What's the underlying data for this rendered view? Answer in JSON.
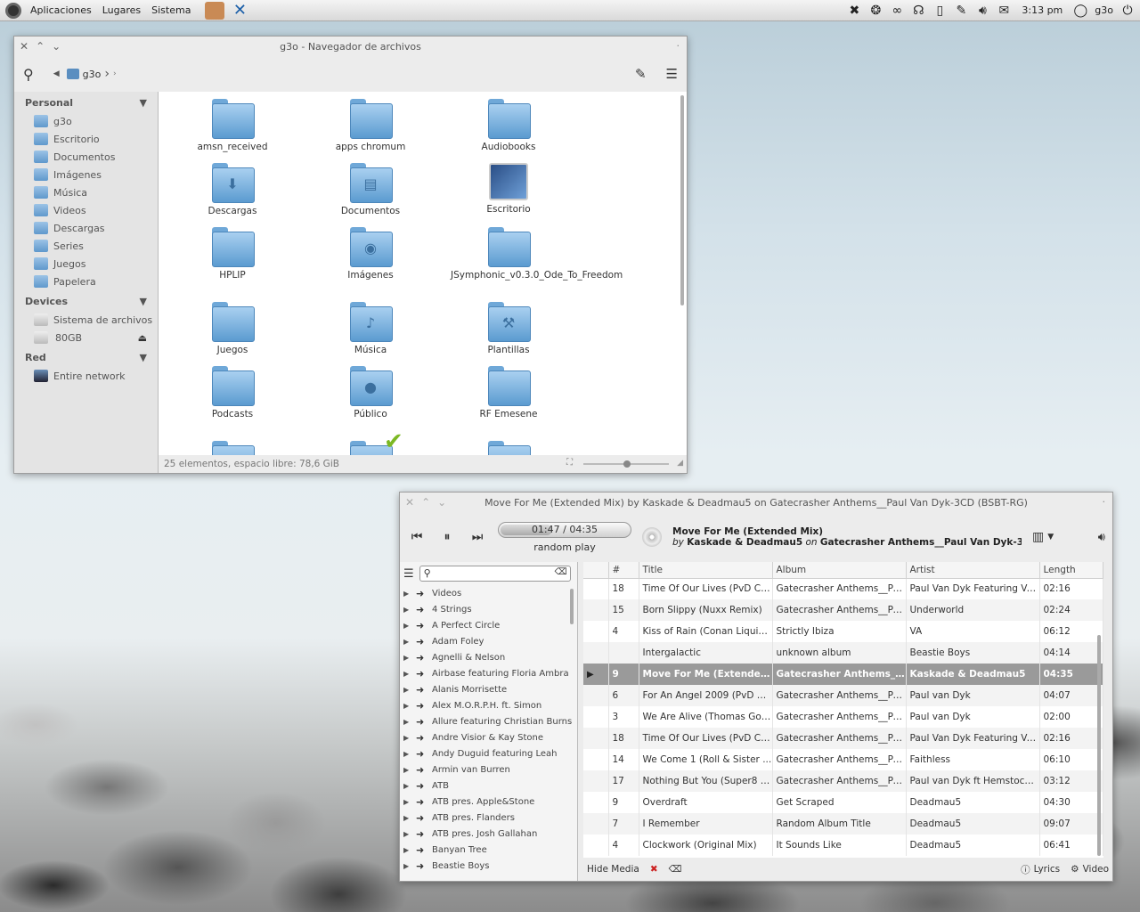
{
  "panel": {
    "menus": [
      "Aplicaciones",
      "Lugares",
      "Sistema"
    ],
    "clock": "3:13 pm",
    "user": "g3o"
  },
  "fm": {
    "title": "g3o - Navegador de archivos",
    "crumb": "g3o",
    "sections": {
      "personal": "Personal",
      "devices": "Devices",
      "network": "Red"
    },
    "personal": [
      "g3o",
      "Escritorio",
      "Documentos",
      "Imágenes",
      "Música",
      "Videos",
      "Descargas",
      "Series",
      "Juegos",
      "Papelera"
    ],
    "devices": [
      "Sistema de archivos",
      "80GB"
    ],
    "network": [
      "Entire network"
    ],
    "icons": [
      "amsn_received",
      "apps chromum",
      "Audiobooks",
      "Descargas",
      "Documentos",
      "Escritorio",
      "HPLIP",
      "Imágenes",
      "JSymphonic_v0.3.0_Ode_To_Freedom",
      "Juegos",
      "Música",
      "Plantillas",
      "Podcasts",
      "Público",
      "RF Emesene"
    ],
    "status": "25 elementos, espacio libre: 78,6 GiB"
  },
  "mp": {
    "title": "Move For Me (Extended Mix) by Kaskade & Deadmau5 on Gatecrasher Anthems__Paul Van Dyk-3CD  (BSBT-RG)",
    "time": "01:47 / 04:35",
    "progress": 0.39,
    "mode": "random play",
    "now_title": "Move For Me (Extended Mix)",
    "now_by": "by",
    "now_artist": "Kaskade & Deadmau5",
    "now_on": "on",
    "now_album": "Gatecrasher Anthems__Paul Van Dyk-3CD  (BSB...",
    "tree": [
      "Videos",
      "4 Strings",
      "A Perfect Circle",
      "Adam Foley",
      "Agnelli & Nelson",
      "Airbase featuring Floria Ambra",
      "Alanis Morrisette",
      "Alex M.O.R.P.H. ft. Simon",
      "Allure featuring Christian Burns",
      "Andre Visior & Kay Stone",
      "Andy Duguid featuring Leah",
      "Armin van Burren",
      "ATB",
      "ATB pres. Apple&Stone",
      "ATB pres. Flanders",
      "ATB pres. Josh Gallahan",
      "Banyan Tree",
      "Beastie Boys"
    ],
    "headers": [
      "#",
      "Title",
      "Album",
      "Artist",
      "Length"
    ],
    "rows": [
      [
        "18",
        "Time Of Our Lives (PvD Cl...",
        "Gatecrasher Anthems__Pau...",
        "Paul Van Dyk Featuring Ve...",
        "02:16"
      ],
      [
        "15",
        "Born Slippy (Nuxx Remix)",
        "Gatecrasher Anthems__Pau...",
        "Underworld",
        "02:24"
      ],
      [
        "4",
        "Kiss of Rain (Conan Liquid ...",
        "Strictly Ibiza",
        "VA",
        "06:12"
      ],
      [
        "",
        "Intergalactic",
        "unknown album",
        "Beastie Boys",
        "04:14"
      ],
      [
        "9",
        "Move For Me (Extended Mix)",
        "Gatecrasher Anthems__Pa...",
        "Kaskade & Deadmau5",
        "04:35"
      ],
      [
        "6",
        "For An Angel 2009 (PvD R...",
        "Gatecrasher Anthems__Pau...",
        "Paul van Dyk",
        "04:07"
      ],
      [
        "3",
        "We Are Alive (Thomas Gold...",
        "Gatecrasher Anthems__Pau...",
        "Paul van Dyk",
        "02:00"
      ],
      [
        "18",
        "Time Of Our Lives (PvD Cl...",
        "Gatecrasher Anthems__Pau...",
        "Paul Van Dyk Featuring Ve...",
        "02:16"
      ],
      [
        "14",
        "We Come 1 (Roll & Sister ...",
        "Gatecrasher Anthems__Pau...",
        "Faithless",
        "06:10"
      ],
      [
        "17",
        "Nothing But You (Super8 &...",
        "Gatecrasher Anthems__Pau...",
        "Paul van Dyk ft Hemstock ...",
        "03:12"
      ],
      [
        "9",
        "Overdraft",
        "Get Scraped",
        "Deadmau5",
        "04:30"
      ],
      [
        "7",
        "I Remember",
        "Random Album Title",
        "Deadmau5",
        "09:07"
      ],
      [
        "4",
        "Clockwork (Original Mix)",
        "It Sounds Like",
        "Deadmau5",
        "06:41"
      ]
    ],
    "selected_row": 4,
    "hide_media": "Hide Media",
    "lyrics": "Lyrics",
    "video": "Video"
  }
}
